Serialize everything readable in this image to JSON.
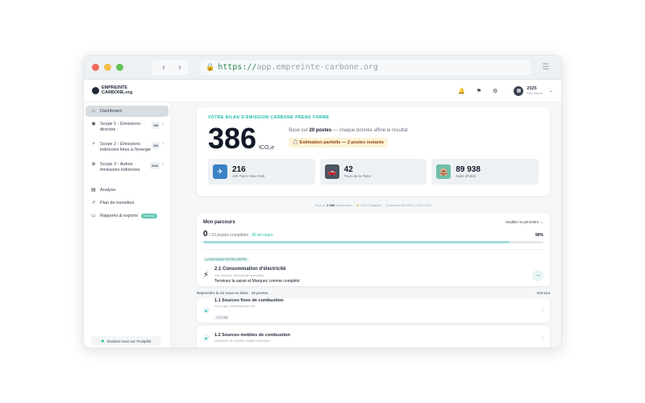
{
  "browser": {
    "url_scheme": "https://",
    "url_host": "app.empreinte-carbone.org",
    "back_icon": "chevron-left",
    "forward_icon": "chevron-right",
    "colors": {
      "close": "#ed6a5e",
      "minimize": "#f5bf4f",
      "maximize": "#61c554"
    }
  },
  "header": {
    "logo_line1": "EMPREINTE",
    "logo_line2": "CARBONE.org",
    "year": "2025",
    "year_sub": "Mes Bilans"
  },
  "sidebar": {
    "items": [
      {
        "label": "Dashboard",
        "icon": "home"
      },
      {
        "label": "Scope 1 - Émissions directes",
        "badge": "0/5"
      },
      {
        "label": "Scope 2 - Émissions indirectes liées à l'énergie",
        "badge": "0/2"
      },
      {
        "label": "Scope 3 - Autres émissions indirectes",
        "badge": "0/15"
      },
      {
        "label": "Analyse"
      },
      {
        "label": "Plan de transition"
      },
      {
        "label": "Rapports & exports",
        "tag": "Nouveau"
      }
    ],
    "trustpilot": "Évaluez-nous sur Trustpilot"
  },
  "hero": {
    "title": "VOTRE BILAN D'ÉMISSION CARBONE PREND FORME",
    "value": "386",
    "unit": "tCO₂e",
    "basis_prefix": "Basé sur",
    "basis_bold": "20 postes",
    "basis_suffix": "— chaque donnée affine le résultat",
    "estimate": "Estimation partielle — 2 postes restants",
    "stats": [
      {
        "value": "216",
        "label": "A/R Paris–New York",
        "color": "#3b82c4"
      },
      {
        "value": "42",
        "label": "Tours de la Terre",
        "color": "#4b5563"
      },
      {
        "value": "89 938",
        "label": "Nuits d'hôtel",
        "color": "#6fbfa7"
      }
    ],
    "footer_prefix": "Plus de",
    "footer_bold": "1 000",
    "footer_suffix": "entreprises",
    "footer_rating": "4.9/5 Trustpilot",
    "footer_conform": "Conforme BEGES & GHG / ISO"
  },
  "parcours": {
    "title": "Mon parcours",
    "modify": "Modifier le périmètre →",
    "count": "0",
    "count_suffix": "/ 22 postes complétés",
    "en_cours": "20 en cours",
    "percent": "90%",
    "progress": 0.9,
    "continue_tag": "● CONTINUEZ ENTRE LIMITÉE",
    "next_title": "2.1 Consommation d'électricité",
    "next_sub": "Vos factures d'électricité annuelles",
    "next_hint": "Terminez la saisie et Marquez comme complété"
  },
  "resume": {
    "heading": "Reprendre là où vous en étiez · 19 postes",
    "see_all": "Voir tout",
    "items": [
      {
        "title": "1.1 Sources fixes de combustion",
        "sub": "Fioul, gaz, biomasse sur site",
        "tag": "⏱ 10 min"
      },
      {
        "title": "1.2 Sources mobiles de combustion",
        "sub": "Véhicules de société, engins carburant",
        "tag": ""
      }
    ]
  }
}
